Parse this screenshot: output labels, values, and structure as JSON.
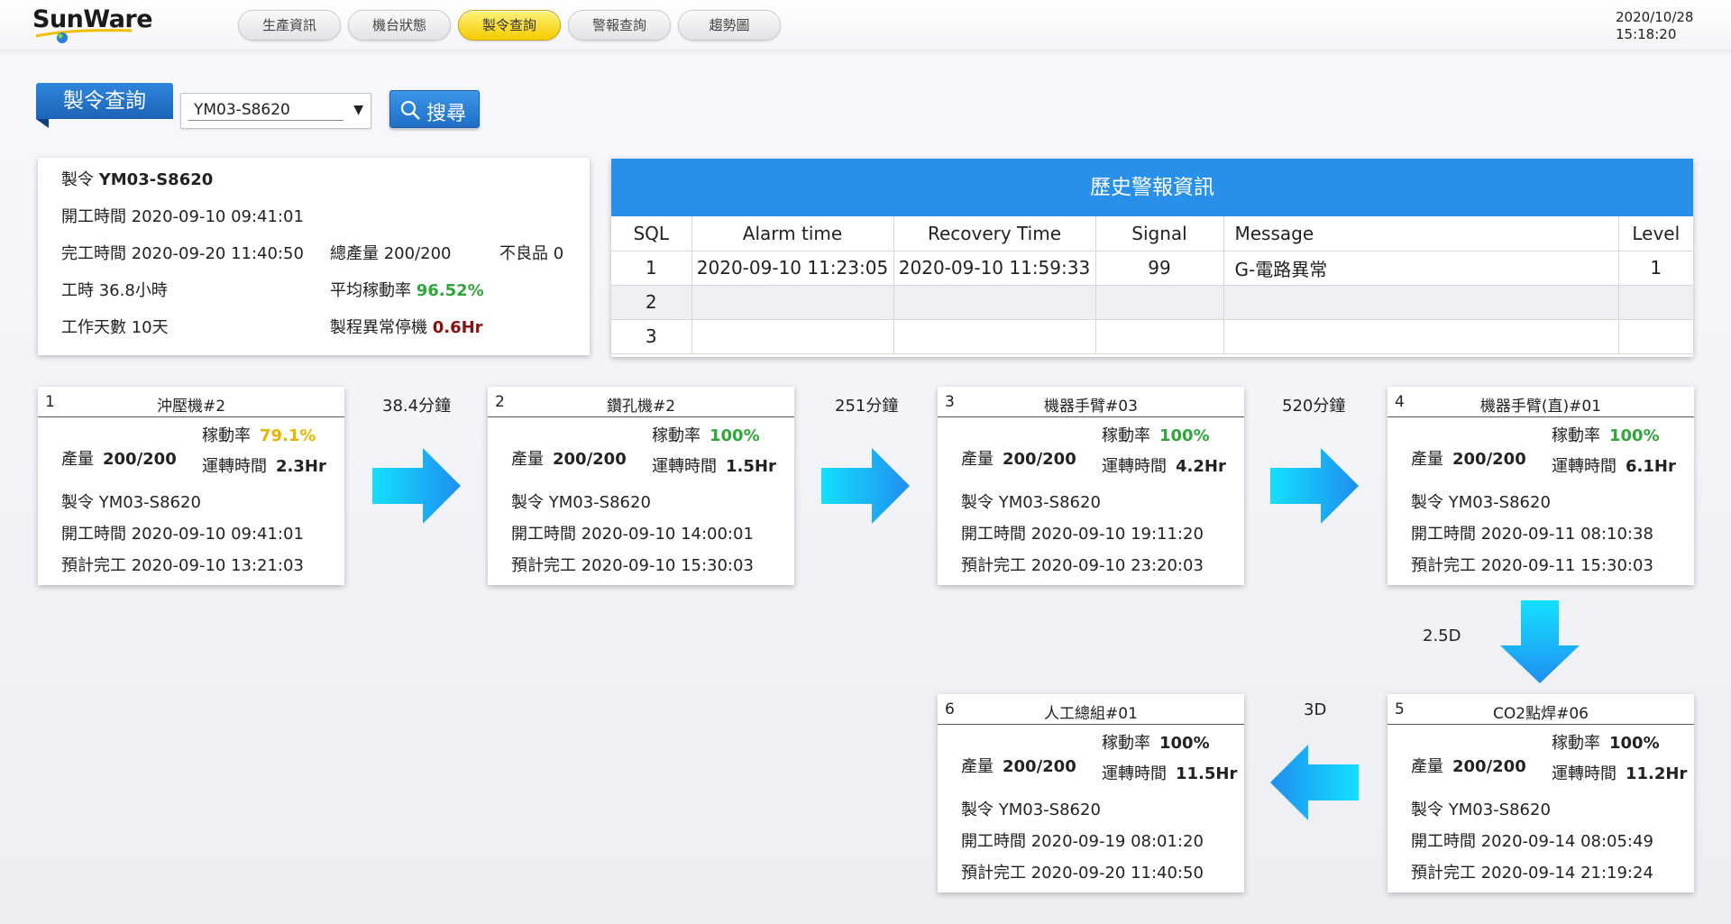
{
  "app": {
    "logo": "SunWare",
    "datetime_date": "2020/10/28",
    "datetime_time": "15:18:20"
  },
  "nav": {
    "tabs": [
      {
        "label": "生產資訊",
        "active": false
      },
      {
        "label": "機台狀態",
        "active": false
      },
      {
        "label": "製令查詢",
        "active": true
      },
      {
        "label": "警報查詢",
        "active": false
      },
      {
        "label": "趨勢圖",
        "active": false
      }
    ]
  },
  "search": {
    "label": "製令查詢",
    "selected_order": "YM03-S8620",
    "button_label": "搜尋"
  },
  "summary": {
    "order_label": "製令",
    "order_value": "YM03-S8620",
    "start_label": "開工時間",
    "start_value": "2020-09-10 09:41:01",
    "finish_label": "完工時間",
    "finish_value": "2020-09-20 11:40:50",
    "total_label": "總產量",
    "total_value": "200/200",
    "defect_label": "不良品",
    "defect_value": "0",
    "hours_label": "工時",
    "hours_value": "36.8小時",
    "avg_rate_label": "平均稼動率",
    "avg_rate_value": "96.52%",
    "days_label": "工作天數",
    "days_value": "10天",
    "abnormal_label": "製程異常停機",
    "abnormal_value": "0.6Hr"
  },
  "alarm": {
    "title": "歷史警報資訊",
    "columns": [
      "SQL",
      "Alarm time",
      "Recovery Time",
      "Signal",
      "Message",
      "Level"
    ],
    "rows": [
      {
        "sql": "1",
        "alarm_time": "2020-09-10 11:23:05",
        "recovery_time": "2020-09-10 11:59:33",
        "signal": "99",
        "message": "G-電路異常",
        "level": "1"
      },
      {
        "sql": "2",
        "alarm_time": "",
        "recovery_time": "",
        "signal": "",
        "message": "",
        "level": ""
      },
      {
        "sql": "3",
        "alarm_time": "",
        "recovery_time": "",
        "signal": "",
        "message": "",
        "level": ""
      }
    ]
  },
  "labels": {
    "qty": "產量",
    "rate": "稼動率",
    "run": "運轉時間",
    "order": "製令",
    "start": "開工時間",
    "plan": "預計完工"
  },
  "processes": [
    {
      "num": "1",
      "name": "沖壓機#2",
      "qty": "200/200",
      "rate": "79.1%",
      "rate_color": "#e8b400",
      "run": "2.3Hr",
      "order": "YM03-S8620",
      "start": "2020-09-10 09:41:01",
      "plan": "2020-09-10 13:21:03"
    },
    {
      "num": "2",
      "name": "鑽孔機#2",
      "qty": "200/200",
      "rate": "100%",
      "rate_color": "#2fa63a",
      "run": "1.5Hr",
      "order": "YM03-S8620",
      "start": "2020-09-10 14:00:01",
      "plan": "2020-09-10 15:30:03"
    },
    {
      "num": "3",
      "name": "機器手臂#03",
      "qty": "200/200",
      "rate": "100%",
      "rate_color": "#2fa63a",
      "run": "4.2Hr",
      "order": "YM03-S8620",
      "start": "2020-09-10 19:11:20",
      "plan": "2020-09-10 23:20:03"
    },
    {
      "num": "4",
      "name": "機器手臂(直)#01",
      "qty": "200/200",
      "rate": "100%",
      "rate_color": "#2fa63a",
      "run": "6.1Hr",
      "order": "YM03-S8620",
      "start": "2020-09-11 08:10:38",
      "plan": "2020-09-11 15:30:03"
    },
    {
      "num": "5",
      "name": "CO2點焊#06",
      "qty": "200/200",
      "rate": "100%",
      "rate_color": "#222222",
      "run": "11.2Hr",
      "order": "YM03-S8620",
      "start": "2020-09-14 08:05:49",
      "plan": "2020-09-14 21:19:24"
    },
    {
      "num": "6",
      "name": "人工總組#01",
      "qty": "200/200",
      "rate": "100%",
      "rate_color": "#222222",
      "run": "11.5Hr",
      "order": "YM03-S8620",
      "start": "2020-09-19 08:01:20",
      "plan": "2020-09-20 11:40:50"
    }
  ],
  "gaps": {
    "g12": "38.4分鐘",
    "g23": "251分鐘",
    "g34": "520分鐘",
    "g45": "2.5D",
    "g56": "3D"
  },
  "colors": {
    "accent_blue": "#2990ea",
    "active_tab": "#f5cc00",
    "arrow_light": "#13e0ff",
    "arrow_dark": "#1f8ef0"
  }
}
